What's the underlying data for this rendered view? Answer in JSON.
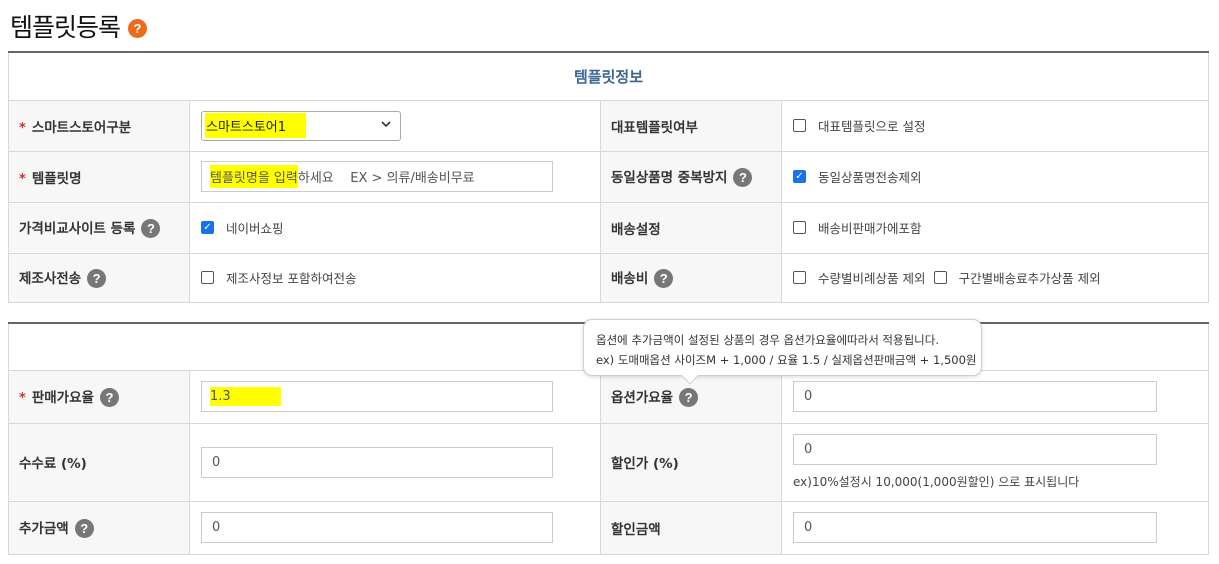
{
  "page": {
    "title": "템플릿등록",
    "help_glyph": "?"
  },
  "info_section": {
    "heading": "템플릿정보",
    "store_type": {
      "label": "스마트스토어구분",
      "required_mark": "*",
      "value": "스마트스토어1"
    },
    "template_name": {
      "label": "템플릿명",
      "required_mark": "*",
      "placeholder_highlight": "템플릿명을 입력",
      "placeholder_rest": "하세요    EX > 의류/배송비무료"
    },
    "price_compare": {
      "label": "가격비교사이트 등록",
      "checkbox_label": "네이버쇼핑",
      "checked": true
    },
    "manufacturer": {
      "label": "제조사전송",
      "checkbox_label": "제조사정보 포함하여전송",
      "checked": false
    },
    "representative": {
      "label": "대표템플릿여부",
      "checkbox_label": "대표템플릿으로 설정",
      "checked": false
    },
    "duplicate_prevent": {
      "label": "동일상품명 중복방지",
      "checkbox_label": "동일상품명전송제외",
      "checked": true
    },
    "shipping_setting": {
      "label": "배송설정",
      "checkbox_label": "배송비판매가에포함",
      "checked": false
    },
    "shipping_fee": {
      "label": "배송비",
      "checkbox1_label": "수량별비례상품 제외",
      "checkbox2_label": "구간별배송료추가상품 제외",
      "checked1": false,
      "checked2": false
    }
  },
  "price_section": {
    "sale_rate": {
      "label": "판매가요율",
      "required_mark": "*",
      "value": "1.3"
    },
    "fee": {
      "label": "수수료 (%)",
      "value": "0"
    },
    "extra_amount": {
      "label": "추가금액",
      "value": "0"
    },
    "option_rate": {
      "label": "옵션가요율",
      "value": "0"
    },
    "discount_rate": {
      "label": "할인가 (%)",
      "value": "0",
      "note": "ex)10%설정시 10,000(1,000원할인) 으로 표시됩니다"
    },
    "discount_amount": {
      "label": "할인금액",
      "value": "0"
    }
  },
  "tooltip": {
    "line1": "옵션에 추가금액이 설정된 상품의 경우 옵션가요율에따라서 적용됩니다.",
    "line2": "ex) 도매매옵션 사이즈M + 1,000 / 요율 1.5 / 실제옵션판매금액 + 1,500원"
  },
  "icons": {
    "help_orange_color": "#ee6b1c",
    "help_gray_color": "#777777",
    "checkbox_checked_color": "#1a73e8",
    "highlight_color": "#ffff00"
  }
}
